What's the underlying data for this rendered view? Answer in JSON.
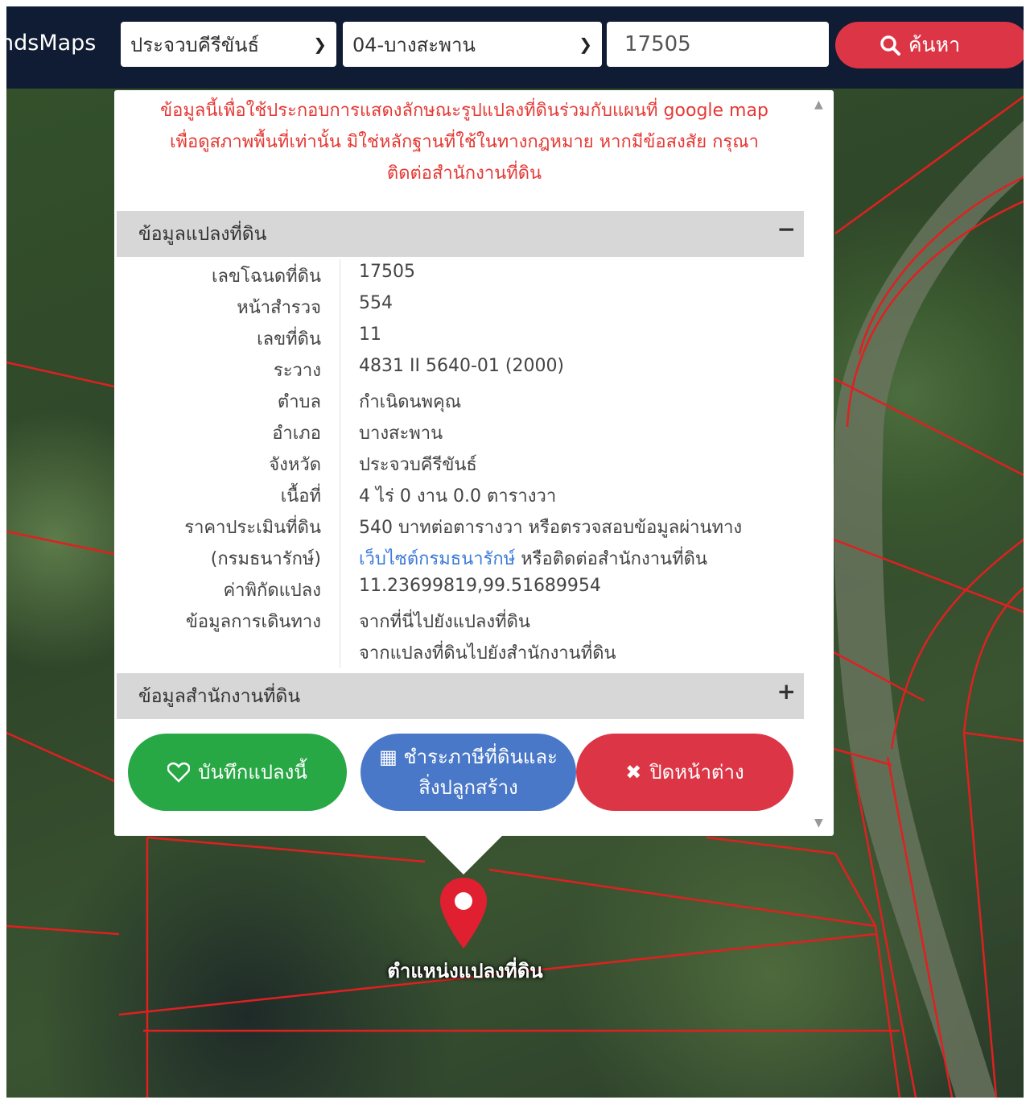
{
  "navbar": {
    "brand": "ndsMaps",
    "province_select": "ประจวบคีรีขันธ์",
    "district_select": "04-บางสะพาน",
    "parcel_input": "17505",
    "search_label": "ค้นหา"
  },
  "popup": {
    "disclaimer_lines": [
      "ข้อมูลนี้เพื่อใช้ประกอบการแสดงลักษณะรูปแปลงที่ดินร่วมกับแผนที่ google map",
      "เพื่อดูสภาพพื้นที่เท่านั้น มิใช่หลักฐานที่ใช้ในทางกฎหมาย หากมีข้อสงสัย กรุณา",
      "ติดต่อสำนักงานที่ดิน"
    ],
    "land_panel": {
      "title": "ข้อมูลแปลงที่ดิน",
      "toggle": "−",
      "rows": [
        {
          "label": "เลขโฉนดที่ดิน",
          "value": "17505"
        },
        {
          "label": "หน้าสำรวจ",
          "value": "554"
        },
        {
          "label": "เลขที่ดิน",
          "value": "11"
        },
        {
          "label": "ระวาง",
          "value": "4831 II 5640-01 (2000)"
        },
        {
          "label": "ตำบล",
          "value": "กำเนิดนพคุณ"
        },
        {
          "label": "อำเภอ",
          "value": "บางสะพาน"
        },
        {
          "label": "จังหวัด",
          "value": "ประจวบคีรีขันธ์"
        },
        {
          "label": "เนื้อที่",
          "value": "4 ไร่ 0 งาน 0.0 ตารางวา"
        },
        {
          "label": "ราคาประเมินที่ดิน",
          "value": "540 บาทต่อตารางวา หรือตรวจสอบข้อมูลผ่านทาง"
        }
      ],
      "dept_label": "(กรมธนารักษ์)",
      "dept_link": "เว็บไซต์กรมธนารักษ์",
      "dept_suffix": " หรือติดต่อสำนักงานที่ดิน",
      "coord_label": "ค่าพิกัดแปลง",
      "coord_value": "11.23699819,99.51689954",
      "travel_label": "ข้อมูลการเดินทาง",
      "travel_link1": "จากที่นี่ไปยังแปลงที่ดิน",
      "travel_link2": "จากแปลงที่ดินไปยังสำนักงานที่ดิน"
    },
    "office_panel": {
      "title": "ข้อมูลสำนักงานที่ดิน",
      "toggle": "+"
    },
    "buttons": {
      "save": "บันทึกแปลงนี้",
      "tax_line1": "ชำระภาษีที่ดินและ",
      "tax_line2": "สิ่งปลูกสร้าง",
      "close": "ปิดหน้าต่าง"
    }
  },
  "marker": {
    "label": "ตำแหน่งแปลงที่ดิน"
  },
  "colors": {
    "navbar": "#0f1c33",
    "accent_red": "#dc3545",
    "green": "#28a745",
    "blue": "#4a78c9",
    "link": "#3d7bd8",
    "disclaimer": "#e53935",
    "parcel_line": "#e02020"
  }
}
